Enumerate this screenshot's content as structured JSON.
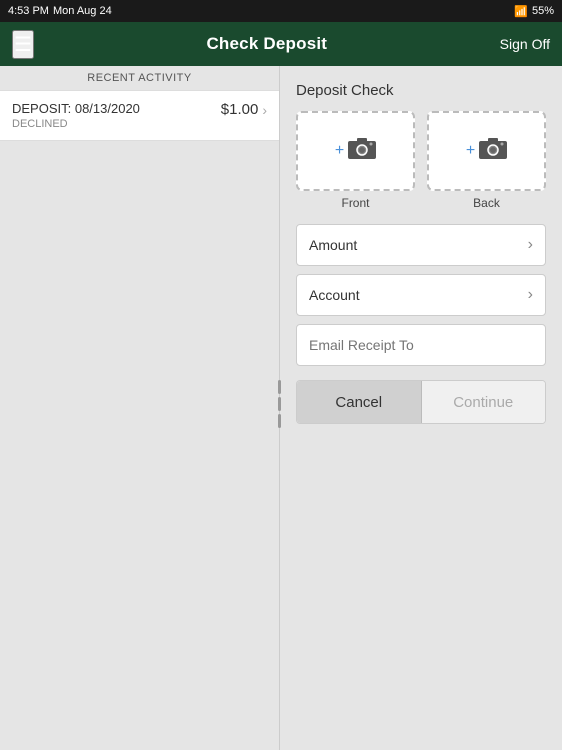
{
  "statusBar": {
    "time": "4:53 PM",
    "day": "Mon Aug 24",
    "wifi": "wifi",
    "battery": "55%"
  },
  "navBar": {
    "menuIcon": "☰",
    "title": "Check Deposit",
    "signOffLabel": "Sign Off"
  },
  "leftPanel": {
    "recentActivityLabel": "RECENT ACTIVITY",
    "depositItem": {
      "label": "DEPOSIT: 08/13/2020",
      "status": "DECLINED",
      "amount": "$1.00"
    }
  },
  "rightPanel": {
    "depositCheckTitle": "Deposit Check",
    "frontPhotoLabel": "Front",
    "backPhotoLabel": "Back",
    "amountLabel": "Amount",
    "accountLabel": "Account",
    "emailPlaceholder": "Email Receipt To",
    "cancelLabel": "Cancel",
    "continueLabel": "Continue"
  }
}
